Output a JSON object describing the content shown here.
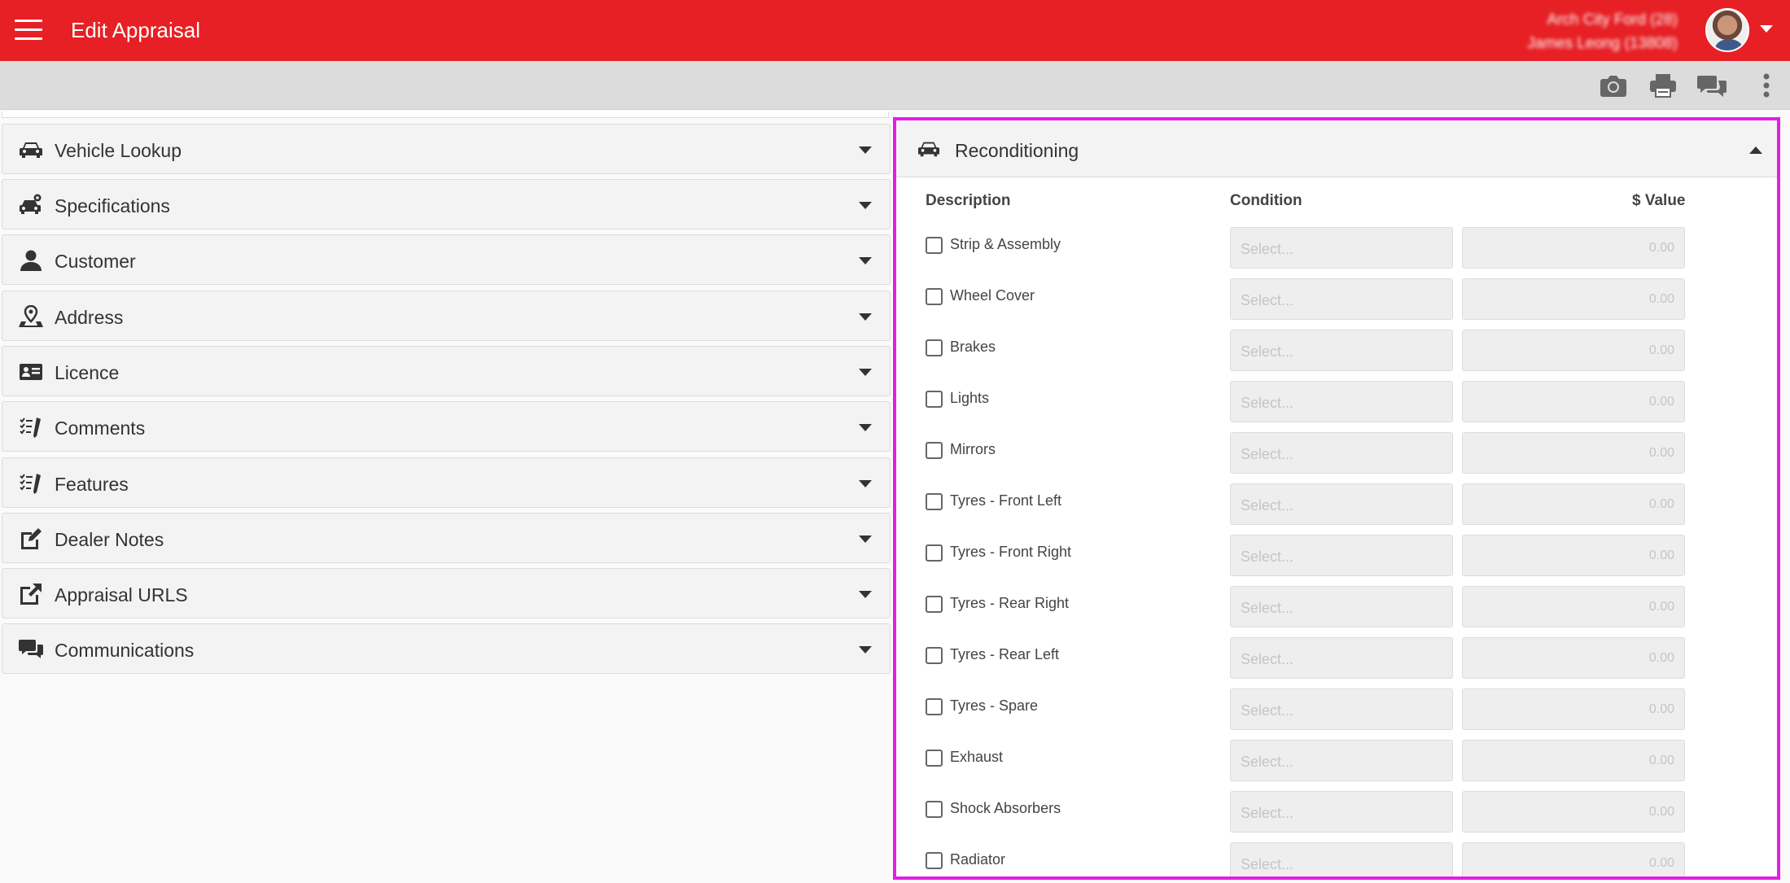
{
  "header": {
    "title": "Edit Appraisal",
    "dealer": "Arch City Ford (28)",
    "user": "James Leong (13808)"
  },
  "toolbar": {
    "icons": [
      "camera-icon",
      "print-icon",
      "chat-icon",
      "more-vert-icon"
    ]
  },
  "sections": [
    {
      "label": "Vehicle Lookup",
      "icon": "car-icon"
    },
    {
      "label": "Specifications",
      "icon": "car-gear-icon"
    },
    {
      "label": "Customer",
      "icon": "person-icon"
    },
    {
      "label": "Address",
      "icon": "map-pin-icon"
    },
    {
      "label": "Licence",
      "icon": "id-card-icon"
    },
    {
      "label": "Comments",
      "icon": "checklist-pen-icon"
    },
    {
      "label": "Features",
      "icon": "checklist-pen-icon"
    },
    {
      "label": "Dealer Notes",
      "icon": "edit-note-icon"
    },
    {
      "label": "Appraisal URLS",
      "icon": "external-link-icon"
    },
    {
      "label": "Communications",
      "icon": "chat-icon"
    }
  ],
  "reconditioning": {
    "title": "Reconditioning",
    "columns": {
      "description": "Description",
      "condition": "Condition",
      "value": "$ Value"
    },
    "select_placeholder": "Select...",
    "value_placeholder": "0.00",
    "rows": [
      "Strip & Assembly",
      "Wheel Cover",
      "Brakes",
      "Lights",
      "Mirrors",
      "Tyres - Front Left",
      "Tyres - Front Right",
      "Tyres - Rear Right",
      "Tyres - Rear Left",
      "Tyres - Spare",
      "Exhaust",
      "Shock Absorbers",
      "Radiator"
    ]
  },
  "colors": {
    "header_bg": "#e62024",
    "toolbar_bg": "#dcdcdc",
    "highlight_border": "#e21ee6"
  }
}
